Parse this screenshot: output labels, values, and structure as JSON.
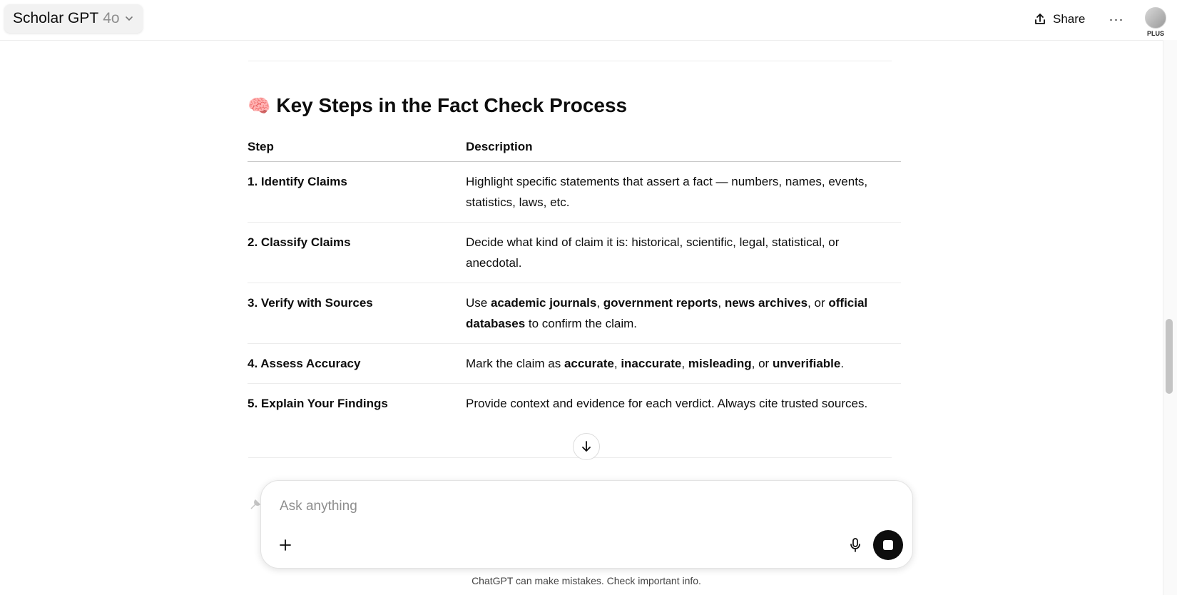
{
  "header": {
    "model_name": "Scholar GPT",
    "model_version": "4o",
    "share_label": "Share",
    "more_label": "···",
    "plan_badge": "PLUS"
  },
  "section": {
    "emoji": "🧠",
    "title": "Key Steps in the Fact Check Process"
  },
  "table": {
    "headers": [
      "Step",
      "Description"
    ],
    "rows": [
      {
        "step": "1. Identify Claims",
        "desc": [
          "Highlight specific statements that assert a fact — numbers, names, events, statistics, laws, etc."
        ]
      },
      {
        "step": "2. Classify Claims",
        "desc": [
          "Decide what kind of claim it is: historical, scientific, legal, statistical, or anecdotal."
        ]
      },
      {
        "step": "3. Verify with Sources",
        "desc": [
          "Use ",
          "academic journals",
          ", ",
          "government reports",
          ", ",
          "news archives",
          ", or ",
          "official databases",
          " to confirm the claim."
        ]
      },
      {
        "step": "4. Assess Accuracy",
        "desc": [
          "Mark the claim as ",
          "accurate",
          ", ",
          "inaccurate",
          ", ",
          "misleading",
          ", or ",
          "unverifiable",
          "."
        ]
      },
      {
        "step": "5. Explain Your Findings",
        "desc": [
          "Provide context and evidence for each verdict. Always cite trusted sources."
        ]
      }
    ]
  },
  "composer": {
    "placeholder": "Ask anything"
  },
  "footer": {
    "disclaimer": "ChatGPT can make mistakes. Check important info."
  },
  "icons": {
    "chevron": "chevron-down-icon",
    "share": "share-upload-icon",
    "scroll_down": "arrow-down-icon",
    "plus": "plus-icon",
    "mic": "microphone-icon",
    "stop": "stop-icon"
  }
}
